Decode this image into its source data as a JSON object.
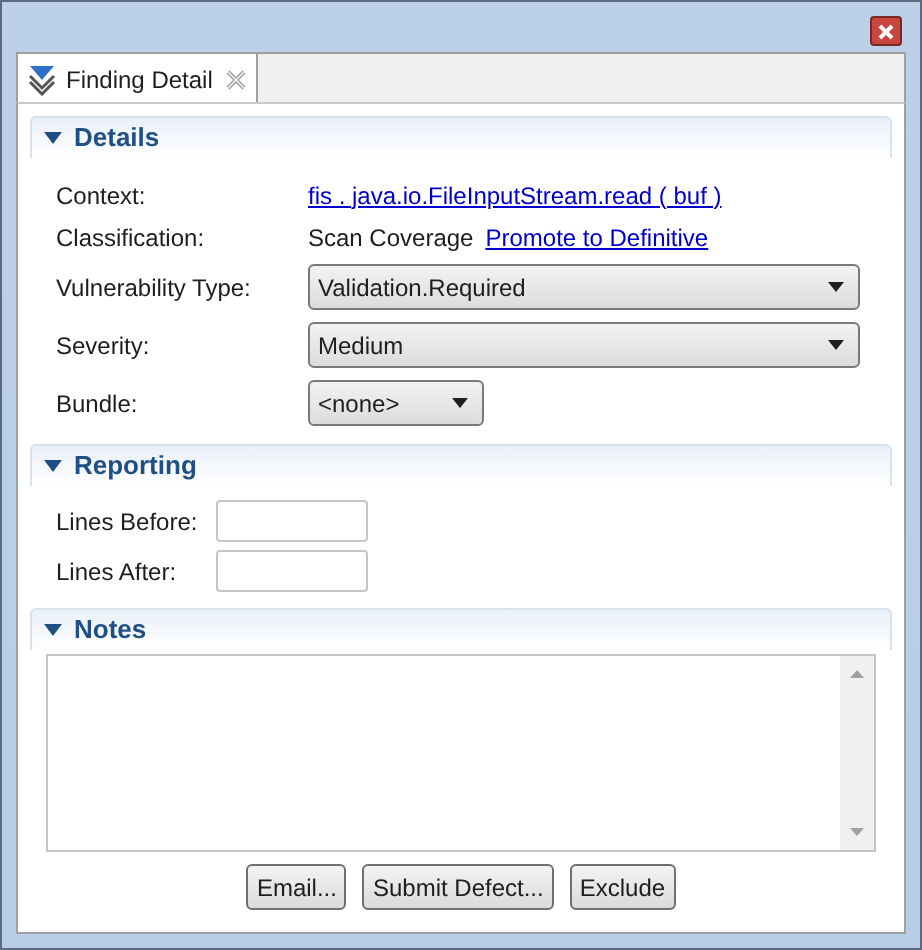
{
  "tab": {
    "label": "Finding Detail",
    "selected": true
  },
  "sections": [
    {
      "kind": "details",
      "title": "Details",
      "expanded": true,
      "rows": [
        {
          "kind": "link",
          "label": "Context:",
          "value": "fis . java.io.FileInputStream.read ( buf )"
        },
        {
          "kind": "text",
          "label": "Classification:",
          "value": "Scan Coverage",
          "link": "Promote to Definitive"
        },
        {
          "kind": "select",
          "label": "Vulnerability Type:",
          "value": "Validation.Required"
        },
        {
          "kind": "select",
          "label": "Severity:",
          "value": "Medium"
        },
        {
          "kind": "small-select",
          "label": "Bundle:",
          "value": "<none>"
        }
      ]
    },
    {
      "kind": "reporting",
      "title": "Reporting",
      "expanded": true,
      "rows": [
        {
          "kind": "input",
          "label": "Lines Before:"
        },
        {
          "kind": "input",
          "label": "Lines After:"
        }
      ]
    },
    {
      "kind": "notes",
      "title": "Notes",
      "expanded": true
    }
  ],
  "buttons": [
    "Email...",
    "Submit Defect...",
    "Exclude"
  ]
}
